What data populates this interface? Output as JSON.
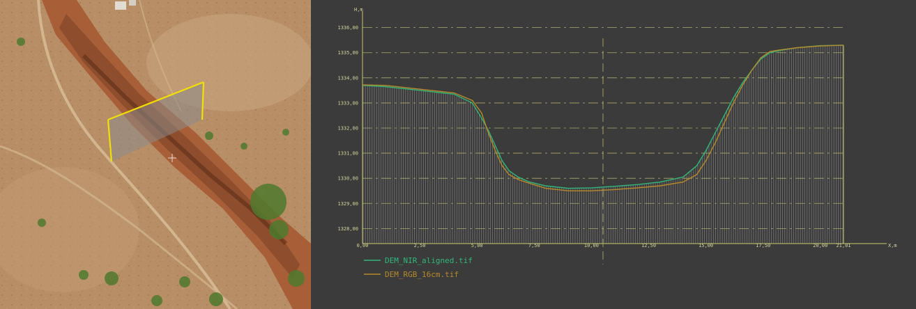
{
  "ortho_view": {
    "description_icons": [
      "crosshair-icon"
    ]
  },
  "profile_view": {
    "colors": {
      "background": "#3b3b3b",
      "axis": "#c8c86a",
      "grid": "#b8b870",
      "fill_lines": "#7c7c7c",
      "nir": "#2fb87a",
      "rgb": "#b88a2a"
    }
  },
  "chart_data": {
    "type": "line",
    "title": "",
    "xlabel": "X,m",
    "ylabel": "H,m",
    "xlim": [
      0,
      21.01
    ],
    "ylim": [
      1327.4,
      1336.6
    ],
    "grid": true,
    "legend_placement": "bottom-left",
    "x_ticks": [
      "0,00",
      "2,50",
      "5,00",
      "7,50",
      "10,00",
      "12,50",
      "15,00",
      "17,50",
      "20,00",
      "21,01"
    ],
    "y_ticks": [
      "1328,00",
      "1329,00",
      "1330,00",
      "1331,00",
      "1332,00",
      "1333,00",
      "1334,00",
      "1335,00",
      "1336,00"
    ],
    "series": [
      {
        "name": "DEM_NIR_aligned.tif",
        "x": [
          0,
          1,
          2,
          3,
          4,
          4.8,
          5.2,
          5.5,
          5.8,
          6.1,
          6.4,
          6.8,
          7.3,
          8,
          9,
          10,
          11,
          12,
          13,
          14,
          14.6,
          15,
          15.4,
          15.8,
          16.2,
          16.6,
          17,
          17.4,
          17.8,
          18.3,
          19,
          20,
          21.01
        ],
        "y": [
          1333.7,
          1333.65,
          1333.55,
          1333.45,
          1333.35,
          1333.0,
          1332.4,
          1331.9,
          1331.3,
          1330.7,
          1330.3,
          1330.05,
          1329.85,
          1329.7,
          1329.6,
          1329.62,
          1329.68,
          1329.75,
          1329.85,
          1330.05,
          1330.5,
          1331.1,
          1331.8,
          1332.5,
          1333.2,
          1333.8,
          1334.3,
          1334.75,
          1335.0,
          1335.1,
          1335.2,
          1335.28,
          1335.3
        ]
      },
      {
        "name": "DEM_RGB_16cm.tif",
        "x": [
          0,
          1,
          2,
          3,
          4,
          4.8,
          5.2,
          5.5,
          5.8,
          6.1,
          6.4,
          6.8,
          7.3,
          8,
          9,
          10,
          11,
          12,
          13,
          14,
          14.6,
          15,
          15.4,
          15.8,
          16.2,
          16.6,
          17,
          17.4,
          17.8,
          18.3,
          19,
          20,
          21.01
        ],
        "y": [
          1333.72,
          1333.7,
          1333.6,
          1333.5,
          1333.4,
          1333.1,
          1332.6,
          1331.8,
          1331.1,
          1330.5,
          1330.15,
          1329.95,
          1329.8,
          1329.6,
          1329.5,
          1329.5,
          1329.55,
          1329.62,
          1329.7,
          1329.85,
          1330.15,
          1330.7,
          1331.4,
          1332.2,
          1333.0,
          1333.7,
          1334.3,
          1334.8,
          1335.05,
          1335.12,
          1335.2,
          1335.27,
          1335.3
        ]
      }
    ]
  }
}
